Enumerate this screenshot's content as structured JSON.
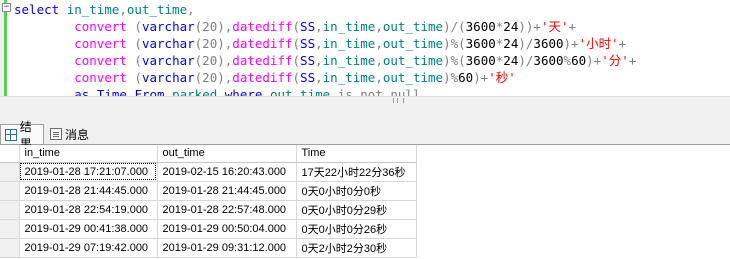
{
  "editor": {
    "collapse_glyph": "−",
    "lines": [
      [
        {
          "t": "select ",
          "c": "kw"
        },
        {
          "t": "in_time",
          "c": "id"
        },
        {
          "t": ",",
          "c": "op"
        },
        {
          "t": "out_time",
          "c": "id"
        },
        {
          "t": ",",
          "c": "op"
        }
      ],
      [
        {
          "t": "        "
        },
        {
          "t": "convert",
          "c": "fn"
        },
        {
          "t": " (",
          "c": "op"
        },
        {
          "t": "varchar",
          "c": "kw"
        },
        {
          "t": "(20),",
          "c": "op"
        },
        {
          "t": "datediff",
          "c": "fn"
        },
        {
          "t": "(",
          "c": "op"
        },
        {
          "t": "SS",
          "c": "kw"
        },
        {
          "t": ",",
          "c": "op"
        },
        {
          "t": "in_time",
          "c": "id"
        },
        {
          "t": ",",
          "c": "op"
        },
        {
          "t": "out_time",
          "c": "id"
        },
        {
          "t": ")/(",
          "c": "op"
        },
        {
          "t": "3600",
          "c": ""
        },
        {
          "t": "*",
          "c": "op"
        },
        {
          "t": "24",
          "c": ""
        },
        {
          "t": "))+",
          "c": "op"
        },
        {
          "t": "'天'",
          "c": "str"
        },
        {
          "t": "+",
          "c": "op"
        }
      ],
      [
        {
          "t": "        "
        },
        {
          "t": "convert",
          "c": "fn"
        },
        {
          "t": " (",
          "c": "op"
        },
        {
          "t": "varchar",
          "c": "kw"
        },
        {
          "t": "(20),",
          "c": "op"
        },
        {
          "t": "datediff",
          "c": "fn"
        },
        {
          "t": "(",
          "c": "op"
        },
        {
          "t": "SS",
          "c": "kw"
        },
        {
          "t": ",",
          "c": "op"
        },
        {
          "t": "in_time",
          "c": "id"
        },
        {
          "t": ",",
          "c": "op"
        },
        {
          "t": "out_time",
          "c": "id"
        },
        {
          "t": ")%(",
          "c": "op"
        },
        {
          "t": "3600",
          "c": ""
        },
        {
          "t": "*",
          "c": "op"
        },
        {
          "t": "24",
          "c": ""
        },
        {
          "t": ")/",
          "c": "op"
        },
        {
          "t": "3600",
          "c": ""
        },
        {
          "t": ")+",
          "c": "op"
        },
        {
          "t": "'小时'",
          "c": "str"
        },
        {
          "t": "+",
          "c": "op"
        }
      ],
      [
        {
          "t": "        "
        },
        {
          "t": "convert",
          "c": "fn"
        },
        {
          "t": " (",
          "c": "op"
        },
        {
          "t": "varchar",
          "c": "kw"
        },
        {
          "t": "(20),",
          "c": "op"
        },
        {
          "t": "datediff",
          "c": "fn"
        },
        {
          "t": "(",
          "c": "op"
        },
        {
          "t": "SS",
          "c": "kw"
        },
        {
          "t": ",",
          "c": "op"
        },
        {
          "t": "in_time",
          "c": "id"
        },
        {
          "t": ",",
          "c": "op"
        },
        {
          "t": "out_time",
          "c": "id"
        },
        {
          "t": ")%(",
          "c": "op"
        },
        {
          "t": "3600",
          "c": ""
        },
        {
          "t": "*",
          "c": "op"
        },
        {
          "t": "24",
          "c": ""
        },
        {
          "t": ")/",
          "c": "op"
        },
        {
          "t": "3600",
          "c": ""
        },
        {
          "t": "%",
          "c": "op"
        },
        {
          "t": "60",
          "c": ""
        },
        {
          "t": ")+",
          "c": "op"
        },
        {
          "t": "'分'",
          "c": "str"
        },
        {
          "t": "+",
          "c": "op"
        }
      ],
      [
        {
          "t": "        "
        },
        {
          "t": "convert",
          "c": "fn"
        },
        {
          "t": " (",
          "c": "op"
        },
        {
          "t": "varchar",
          "c": "kw"
        },
        {
          "t": "(20),",
          "c": "op"
        },
        {
          "t": "datediff",
          "c": "fn"
        },
        {
          "t": "(",
          "c": "op"
        },
        {
          "t": "SS",
          "c": "kw"
        },
        {
          "t": ",",
          "c": "op"
        },
        {
          "t": "in_time",
          "c": "id"
        },
        {
          "t": ",",
          "c": "op"
        },
        {
          "t": "out_time",
          "c": "id"
        },
        {
          "t": ")%",
          "c": "op"
        },
        {
          "t": "60",
          "c": ""
        },
        {
          "t": ")+",
          "c": "op"
        },
        {
          "t": "'秒'",
          "c": "str"
        }
      ],
      [
        {
          "t": "        "
        },
        {
          "t": "as",
          "c": "kw"
        },
        {
          "t": " "
        },
        {
          "t": "Time",
          "c": "kw"
        },
        {
          "t": " "
        },
        {
          "t": "From",
          "c": "kw"
        },
        {
          "t": " "
        },
        {
          "t": "parked",
          "c": "id"
        },
        {
          "t": " "
        },
        {
          "t": "where",
          "c": "kw"
        },
        {
          "t": " "
        },
        {
          "t": "out_time",
          "c": "id"
        },
        {
          "t": " "
        },
        {
          "t": "is not null",
          "c": "op"
        }
      ]
    ]
  },
  "tabs": {
    "results_label": "结果",
    "messages_label": "消息",
    "results_icon": "grid-icon",
    "messages_icon": "messages-icon"
  },
  "grid": {
    "columns": [
      "in_time",
      "out_time",
      "Time"
    ],
    "rows": [
      [
        "2019-01-28 17:21:07.000",
        "2019-02-15 16:20:43.000",
        "17天22小时22分36秒"
      ],
      [
        "2019-01-28 21:44:45.000",
        "2019-01-28 21:44:45.000",
        "0天0小时0分0秒"
      ],
      [
        "2019-01-28 22:54:19.000",
        "2019-01-28 22:57:48.000",
        "0天0小时0分29秒"
      ],
      [
        "2019-01-29 00:41:38.000",
        "2019-01-29 00:50:04.000",
        "0天0小时0分26秒"
      ],
      [
        "2019-01-29 07:19:42.000",
        "2019-01-29 09:31:12.000",
        "0天2小时2分30秒"
      ]
    ]
  }
}
